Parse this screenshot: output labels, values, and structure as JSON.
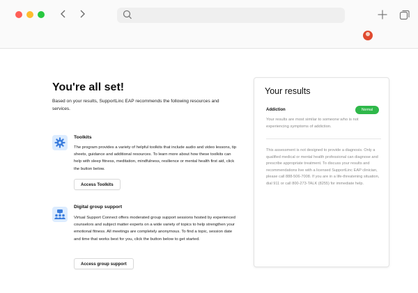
{
  "browser": {
    "address_value": "",
    "controls": {
      "back_icon": "chevron-left-icon",
      "forward_icon": "chevron-right-icon",
      "new_tab_icon": "plus-icon",
      "tabs_icon": "tabs-overview-icon"
    },
    "colors": {
      "close": "#ff5f57",
      "minimize": "#febc2e",
      "maximize": "#28c840"
    }
  },
  "page": {
    "title": "You're all set!",
    "intro": "Based on your results, SupportLinc EAP recommends the following resources and services."
  },
  "services": [
    {
      "icon": "gear-icon",
      "heading": "Toolkits",
      "description": "The program provides a variety of helpful toolkits that include audio and video lessons, tip sheets, guidance and additional resources. To learn more about how these toolkits can help with sleep fitness, meditation, mindfulness, resilience or mental health first aid, click the button below.",
      "button_label": "Access Toolkits"
    },
    {
      "icon": "group-chat-icon",
      "heading": "Digital group support",
      "description": "Virtual Support Connect offers moderated group support sessions hosted by experienced counselors and subject matter experts on a wide variety of topics to help strengthen your emotional fitness. All meetings are completely anonymous. To find a topic, session date and time that works best for you, click the button below to get started.",
      "button_label": "Access group support"
    }
  ],
  "results": {
    "title": "Your results",
    "category": "Addiction",
    "status": "Normal",
    "status_color": "#2fb84a",
    "summary": "Your results are most similar to someone who is not experiencing symptoms of addiction.",
    "disclaimer": "This assessment is not designed to provide a diagnosis. Only a qualified medical or mental health professional can diagnose and prescribe appropriate treatment. To discuss your results and recommendations live with a licensed SupportLinc EAP clinician, please call 888-506-7008. If you are in a life-threatening situation, dial 911 or call 800-273-TALK (8255) for immediate help."
  }
}
